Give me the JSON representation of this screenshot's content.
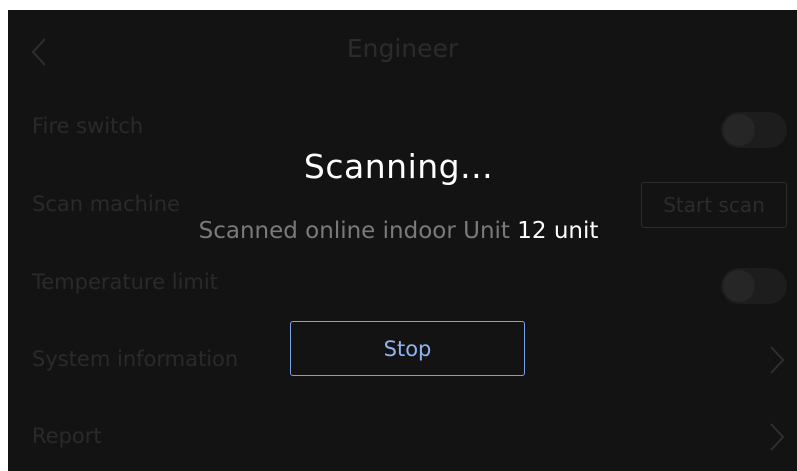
{
  "header": {
    "title": "Engineer",
    "back_icon": "chevron-left-icon"
  },
  "settings": {
    "fire_switch": {
      "label": "Fire switch",
      "control": "toggle",
      "enabled": false
    },
    "scan_machine": {
      "label": "Scan machine",
      "button_label": "Start scan"
    },
    "temperature_limit": {
      "label": "Temperature limit",
      "control": "toggle",
      "enabled": false
    },
    "system_information": {
      "label": "System information",
      "icon": "chevron-right-icon"
    },
    "report": {
      "label": "Report",
      "icon": "chevron-right-icon"
    }
  },
  "dialog": {
    "title": "Scanning...",
    "status_text": "Scanned online indoor Unit",
    "count_text": "12 unit",
    "stop_label": "Stop"
  },
  "colors": {
    "background": "#131313",
    "text_primary": "#ffffff",
    "text_muted": "#7a7a7a",
    "accent": "#8fb3f0"
  }
}
